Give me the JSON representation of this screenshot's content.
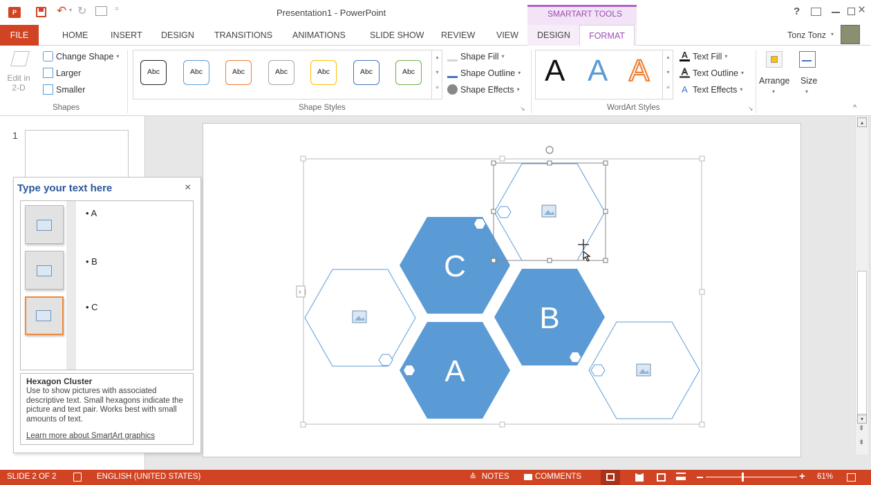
{
  "app": {
    "title": "Presentation1 - PowerPoint",
    "context_tab_group": "SMARTART TOOLS",
    "help": "?",
    "user": "Tonz Tonz"
  },
  "tabs": [
    "FILE",
    "HOME",
    "INSERT",
    "DESIGN",
    "TRANSITIONS",
    "ANIMATIONS",
    "SLIDE SHOW",
    "REVIEW",
    "VIEW",
    "DESIGN",
    "FORMAT"
  ],
  "ribbon": {
    "shapes": {
      "edit_2d": "Edit in 2-D",
      "change_shape": "Change Shape",
      "larger": "Larger",
      "smaller": "Smaller",
      "label": "Shapes"
    },
    "shape_styles": {
      "abc": [
        "Abc",
        "Abc",
        "Abc",
        "Abc",
        "Abc",
        "Abc",
        "Abc"
      ],
      "abc_colors": [
        "#222222",
        "#5b9bd5",
        "#ed7d31",
        "#a5a5a5",
        "#ffc000",
        "#4472c4",
        "#70ad47"
      ],
      "shape_fill": "Shape Fill",
      "shape_outline": "Shape Outline",
      "shape_effects": "Shape Effects",
      "label": "Shape Styles"
    },
    "wordart": {
      "letters": [
        "A",
        "A",
        "A"
      ],
      "text_fill": "Text Fill",
      "text_outline": "Text Outline",
      "text_effects": "Text Effects",
      "label": "WordArt Styles"
    },
    "arrange": "Arrange",
    "size": "Size"
  },
  "thumbnail": {
    "number": "1"
  },
  "text_pane": {
    "title": "Type your text here",
    "close": "×",
    "items": [
      "A",
      "B",
      "C"
    ],
    "layout_name": "Hexagon Cluster",
    "description": "Use to show pictures with associated descriptive text. Small hexagons indicate the picture and text pair. Works best with small amounts of text.",
    "learn_more": "Learn more about SmartArt graphics"
  },
  "smartart": {
    "labels": [
      "C",
      "B",
      "A"
    ],
    "fill_color": "#5b9bd5",
    "outline_color": "#5b9bd5",
    "expand_arrow": "›"
  },
  "status": {
    "slide": "SLIDE 2 OF 2",
    "language": "ENGLISH (UNITED STATES)",
    "notes": "NOTES",
    "comments": "COMMENTS",
    "zoom": "61%",
    "bar_color": "#d04423"
  }
}
